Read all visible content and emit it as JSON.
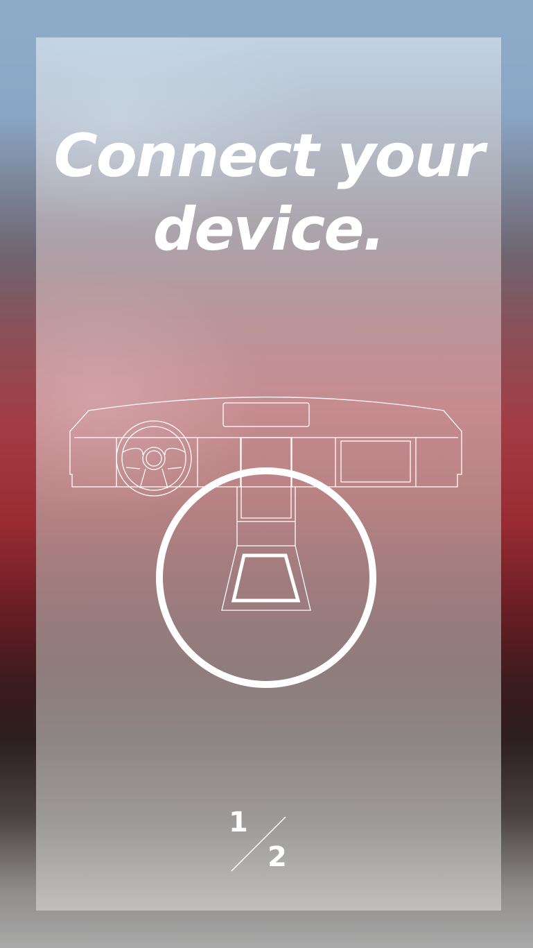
{
  "onboarding": {
    "title_line1": "Connect your",
    "title_line2": "device.",
    "illustration": "car-dashboard-icon",
    "pager": {
      "current": "1",
      "total": "2"
    }
  },
  "colors": {
    "text": "#ffffff",
    "accent_red": "#a23c44",
    "accent_blue": "#8eacca"
  }
}
